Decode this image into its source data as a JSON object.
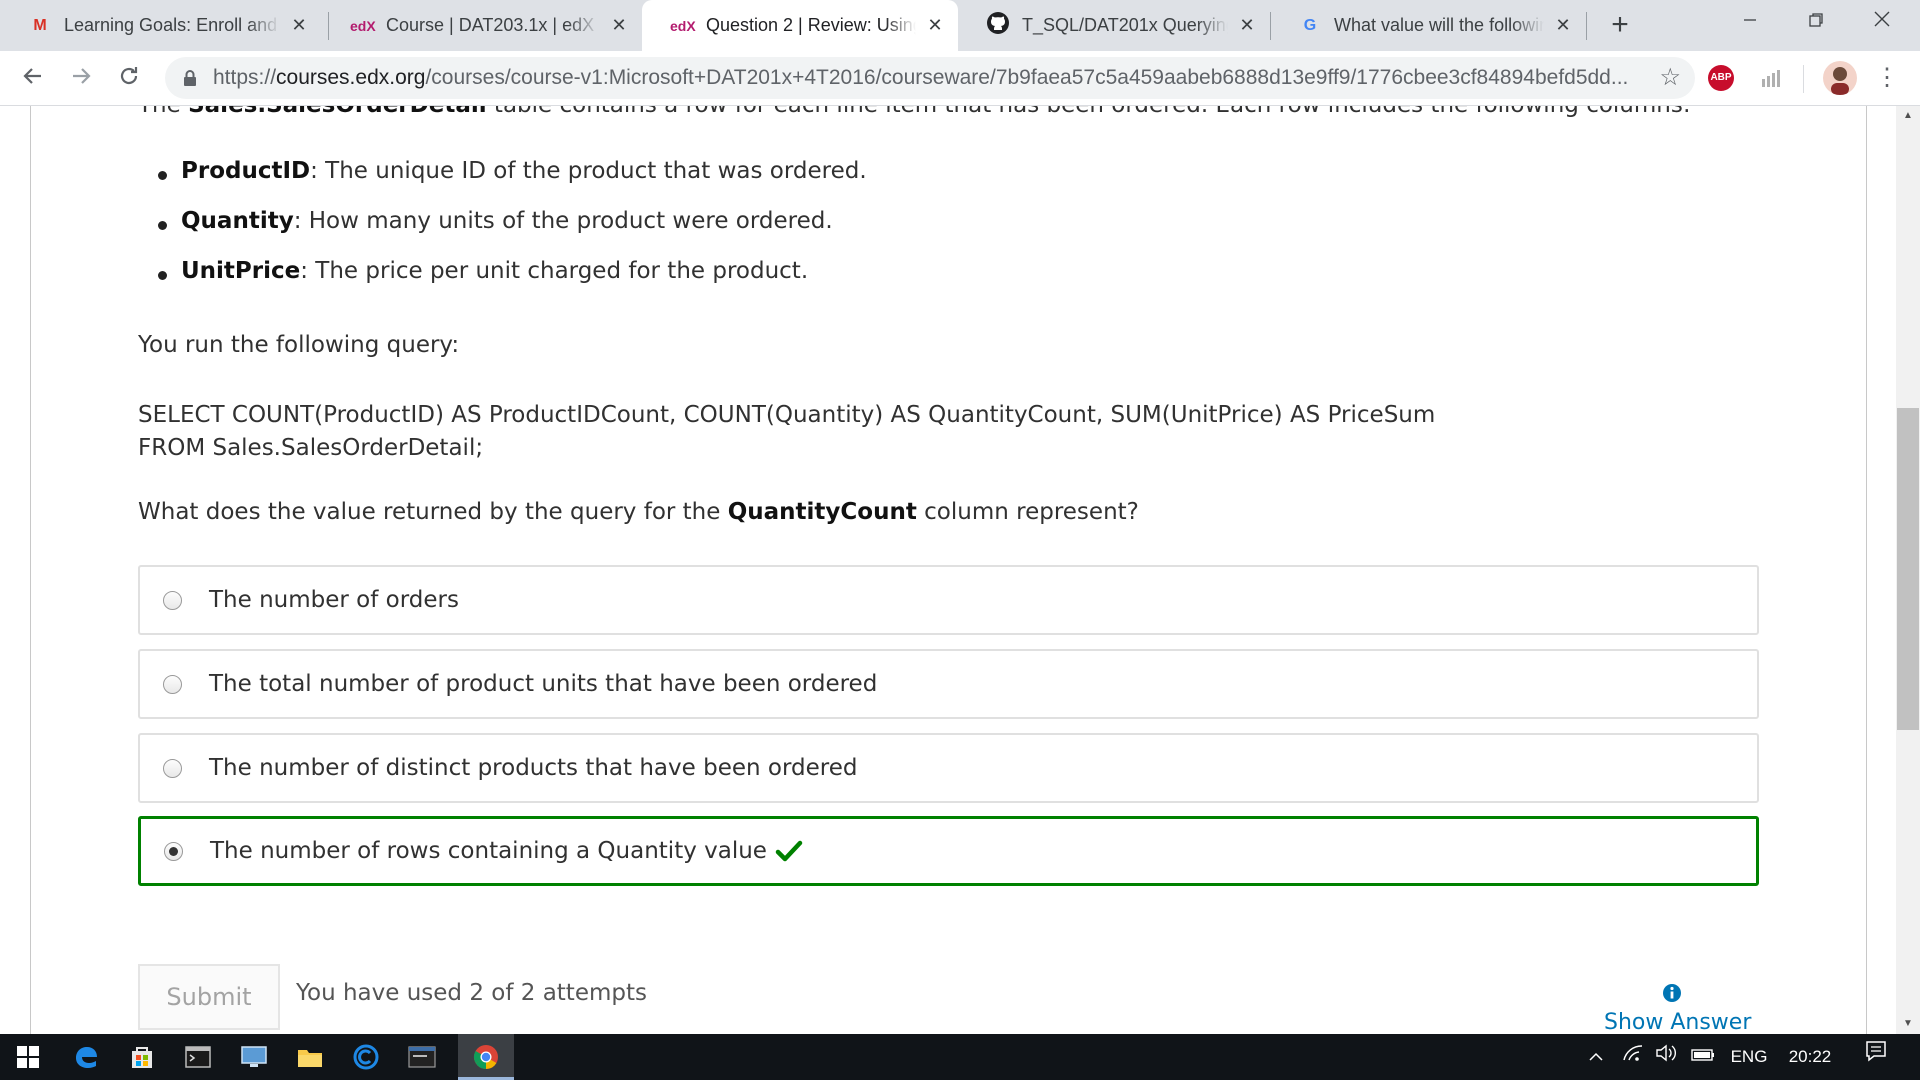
{
  "browser": {
    "tabs": [
      {
        "favicon": "M",
        "title": "Learning Goals: Enroll and c",
        "active": false
      },
      {
        "favicon": "edX",
        "title": "Course | DAT203.1x | edX",
        "active": false
      },
      {
        "favicon": "edX",
        "title": "Question 2 | Review: Using I",
        "active": true
      },
      {
        "favicon": "github",
        "title": "T_SQL/DAT201x Querying w",
        "active": false
      },
      {
        "favicon": "G",
        "title": "What value will the followin",
        "active": false
      }
    ],
    "new_tab": "+",
    "close_glyph": "✕",
    "url_scheme": "https://",
    "url_host": "courses.edx.org",
    "url_path": "/courses/course-v1:Microsoft+DAT201x+4T2016/courseware/7b9faea57c5a459aabeb6888d13e9ff9/1776cbee3cf84894befd5dd...",
    "abp_label": "ABP"
  },
  "page": {
    "intro_prefix": "The ",
    "intro_table": "Sales.SalesOrderDetail",
    "intro_suffix": " table contains a row for each line item that has been ordered. Each row includes the following columns:",
    "columns": [
      {
        "name": "ProductID",
        "desc": ": The unique ID of the product that was ordered."
      },
      {
        "name": "Quantity",
        "desc": ": How many units of the product were ordered."
      },
      {
        "name": "UnitPrice",
        "desc": ": The price per unit charged for the product."
      }
    ],
    "run_query_text": "You run the following query:",
    "sql_line1": "SELECT COUNT(ProductID) AS ProductIDCount, COUNT(Quantity) AS QuantityCount, SUM(UnitPrice) AS PriceSum",
    "sql_line2": "FROM Sales.SalesOrderDetail;",
    "question_prefix": "What does the value returned by the query for the ",
    "question_bold": "QuantityCount",
    "question_suffix": " column represent?",
    "choices": [
      {
        "label": "The number of orders",
        "selected": false,
        "correct": false
      },
      {
        "label": "The total number of product units that have been ordered",
        "selected": false,
        "correct": false
      },
      {
        "label": "The number of distinct products that have been ordered",
        "selected": false,
        "correct": false
      },
      {
        "label": "The number of rows containing a Quantity value",
        "selected": true,
        "correct": true
      }
    ],
    "submit_label": "Submit",
    "attempts_text": "You have used 2 of 2 attempts",
    "show_answer_label": "Show Answer"
  },
  "colors": {
    "correct_border": "#008100",
    "link": "#0075b4"
  },
  "taskbar": {
    "language": "ENG",
    "time": "20:22"
  }
}
